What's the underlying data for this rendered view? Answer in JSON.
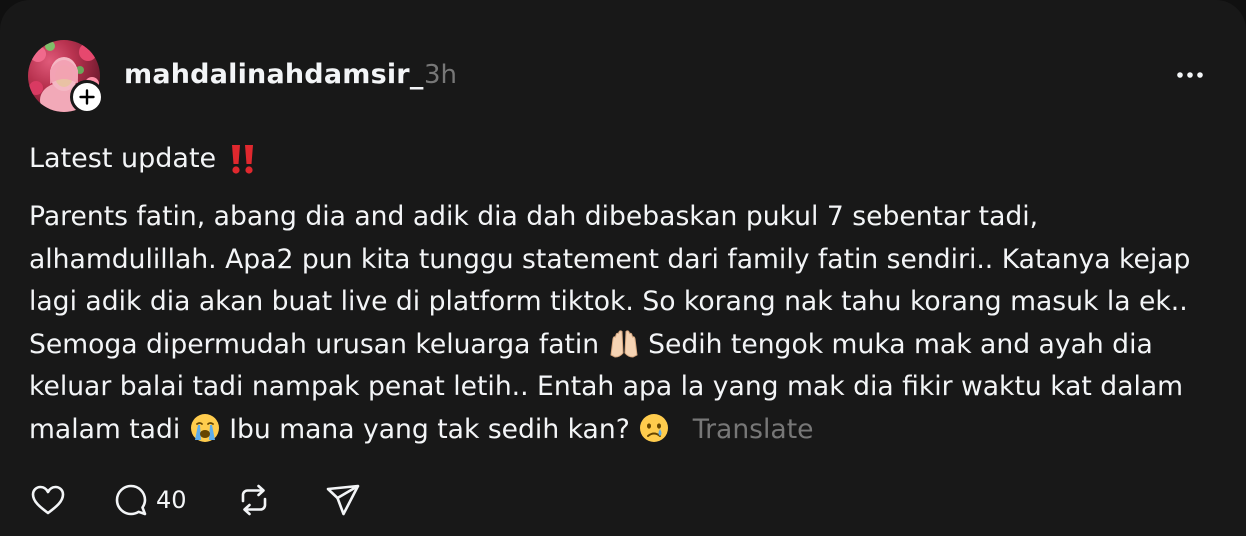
{
  "post": {
    "author": "mahdalinahdamsir_",
    "time": "3h",
    "headline": "Latest update",
    "body_lines": [
      "Parents fatin, abang dia and adik dia dah dibebaskan pukul 7 sebentar tadi,",
      "alhamdulillah. Apa2 pun kita tunggu statement dari family fatin sendiri.. Katanya kejap",
      "lagi adik dia akan buat live di platform tiktok. So korang nak tahu korang masuk la ek..",
      "Semoga dipermudah urusan keluarga fatin",
      "Sedih tengok muka mak and ayah dia",
      "keluar balai tadi nampak penat letih.. Entah apa la yang mak dia fikir waktu kat dalam",
      "malam tadi",
      "Ibu mana yang tak sedih kan?"
    ],
    "translate_label": "Translate",
    "reply_count": "40",
    "icons": {
      "more": "more-horizontal-icon",
      "follow": "plus-icon",
      "headline_emoji": "double-exclamation-icon",
      "hands_emoji": "raised-hands-icon",
      "cry_loud_emoji": "loudly-crying-face-icon",
      "cry_emoji": "crying-face-icon",
      "like": "heart-icon",
      "reply": "comment-icon",
      "repost": "repost-icon",
      "share": "send-icon"
    },
    "colors": {
      "background": "#181818",
      "text": "#f3f5f7",
      "muted": "#777777",
      "alert": "#e0282e"
    }
  }
}
